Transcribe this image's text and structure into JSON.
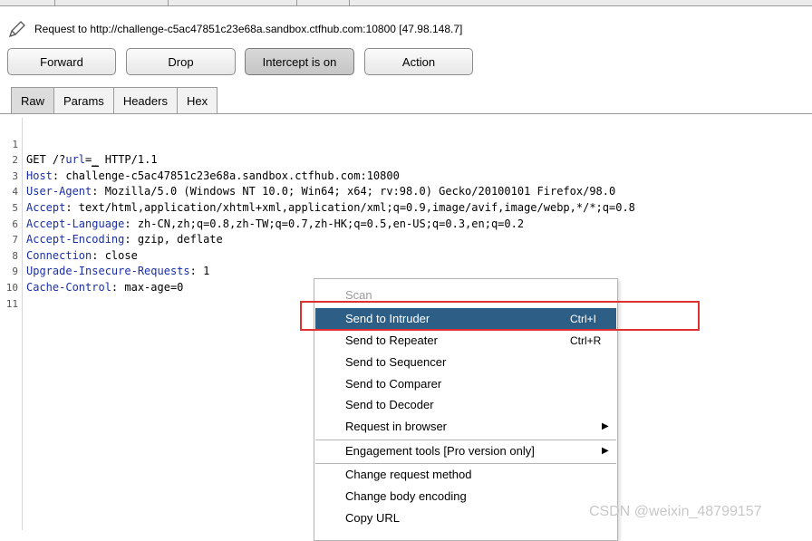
{
  "request": {
    "title": "Request to http://challenge-c5ac47851c23e68a.sandbox.ctfhub.com:10800  [47.98.148.7]"
  },
  "toolbar": {
    "forward_label": "Forward",
    "drop_label": "Drop",
    "intercept_label": "Intercept is on",
    "action_label": "Action"
  },
  "subtabs": [
    "Raw",
    "Params",
    "Headers",
    "Hex"
  ],
  "active_subtab": "Raw",
  "editor": {
    "lines": [
      {
        "n": "1",
        "name": "",
        "rest": ""
      },
      {
        "n": "2",
        "name": "Host",
        "rest": ": challenge-c5ac47851c23e68a.sandbox.ctfhub.com:10800"
      },
      {
        "n": "3",
        "name": "User-Agent",
        "rest": ": Mozilla/5.0 (Windows NT 10.0; Win64; x64; rv:98.0) Gecko/20100101 Firefox/98.0"
      },
      {
        "n": "4",
        "name": "Accept",
        "rest": ": text/html,application/xhtml+xml,application/xml;q=0.9,image/avif,image/webp,*/*;q=0.8"
      },
      {
        "n": "5",
        "name": "Accept-Language",
        "rest": ": zh-CN,zh;q=0.8,zh-TW;q=0.7,zh-HK;q=0.5,en-US;q=0.3,en;q=0.2"
      },
      {
        "n": "6",
        "name": "Accept-Encoding",
        "rest": ": gzip, deflate"
      },
      {
        "n": "7",
        "name": "Connection",
        "rest": ": close"
      },
      {
        "n": "8",
        "name": "Upgrade-Insecure-Requests",
        "rest": ": 1"
      },
      {
        "n": "9",
        "name": "Cache-Control",
        "rest": ": max-age=0"
      },
      {
        "n": "10",
        "name": "",
        "rest": ""
      },
      {
        "n": "11",
        "name": "",
        "rest": ""
      }
    ],
    "request_line": {
      "method": "GET /?",
      "param": "url",
      "eq": "=",
      "cursor": "_",
      "proto": " HTTP/1.1"
    }
  },
  "context_menu": {
    "items": [
      {
        "label": "Scan",
        "accel": "",
        "disabled": true,
        "selected": false,
        "submenu": false
      },
      {
        "label": "Send to Intruder",
        "accel": "Ctrl+I",
        "disabled": false,
        "selected": true,
        "submenu": false
      },
      {
        "label": "Send to Repeater",
        "accel": "Ctrl+R",
        "disabled": false,
        "selected": false,
        "submenu": false
      },
      {
        "label": "Send to Sequencer",
        "accel": "",
        "disabled": false,
        "selected": false,
        "submenu": false
      },
      {
        "label": "Send to Comparer",
        "accel": "",
        "disabled": false,
        "selected": false,
        "submenu": false
      },
      {
        "label": "Send to Decoder",
        "accel": "",
        "disabled": false,
        "selected": false,
        "submenu": false
      },
      {
        "label": "Request in browser",
        "accel": "",
        "disabled": false,
        "selected": false,
        "submenu": true
      },
      {
        "label": "Engagement tools [Pro version only]",
        "accel": "",
        "disabled": false,
        "selected": false,
        "submenu": true
      },
      {
        "label": "Change request method",
        "accel": "",
        "disabled": false,
        "selected": false,
        "submenu": false
      },
      {
        "label": "Change body encoding",
        "accel": "",
        "disabled": false,
        "selected": false,
        "submenu": false
      },
      {
        "label": "Copy URL",
        "accel": "",
        "disabled": false,
        "selected": false,
        "submenu": false
      }
    ]
  },
  "watermark": "CSDN @weixin_48799157",
  "colors": {
    "header_name": "#1a2fa8",
    "menu_selected": "#2d5f86",
    "annotation_box": "#e03131"
  },
  "icons": {
    "edit": "pencil-icon",
    "submenu": "submenu-arrow-icon"
  }
}
